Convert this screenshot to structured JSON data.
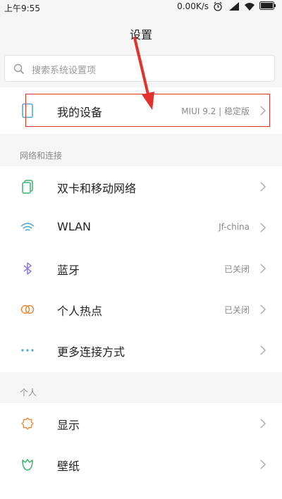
{
  "status_bar": {
    "time": "上午9:55",
    "speed": "0.00K/s"
  },
  "header": {
    "title": "设置"
  },
  "search": {
    "placeholder": "搜索系统设置项"
  },
  "my_device": {
    "label": "我的设备",
    "value": "MIUI 9.2 | 稳定版"
  },
  "network": {
    "section_title": "网络和连接",
    "items": [
      {
        "label": "双卡和移动网络",
        "value": "",
        "icon": "sim-card-icon"
      },
      {
        "label": "WLAN",
        "value": "Jf-china",
        "icon": "wifi-icon"
      },
      {
        "label": "蓝牙",
        "value": "已关闭",
        "icon": "bluetooth-icon"
      },
      {
        "label": "个人热点",
        "value": "已关闭",
        "icon": "hotspot-icon"
      },
      {
        "label": "更多连接方式",
        "value": "",
        "icon": "more-dots-icon"
      }
    ]
  },
  "personal": {
    "section_title": "个人",
    "items": [
      {
        "label": "显示",
        "value": "",
        "icon": "display-sun-icon"
      },
      {
        "label": "壁纸",
        "value": "",
        "icon": "wallpaper-icon"
      }
    ]
  },
  "colors": {
    "accent_blue": "#4aa8d8",
    "annotation_red": "#e3322e",
    "icon_orange": "#e98b3a",
    "icon_green": "#3cb371",
    "icon_purple": "#8f7fd6"
  }
}
